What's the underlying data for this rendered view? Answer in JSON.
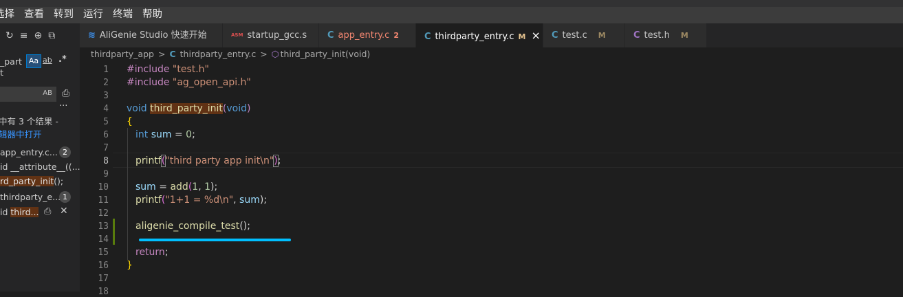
{
  "menu": {
    "items": [
      "选择",
      "查看",
      "转到",
      "运行",
      "终端",
      "帮助"
    ]
  },
  "sidebar": {
    "tools": [
      "↻",
      "≡",
      "⊕",
      "⧉"
    ],
    "search_prefix": "_part",
    "search_fragment": "t",
    "opt_case": "Aa",
    "opt_word": "ab",
    "opt_regex": ".*",
    "replace_opt": "AB",
    "more": "···",
    "result_text": "中有 3 个结果 -",
    "open_link": "辑器中打开",
    "results": [
      {
        "file": "app_entry.c...",
        "badge": "2"
      },
      {
        "line": "id __attribute__((..."
      },
      {
        "line_hl": "rd_party_init",
        "line_tail": "();"
      },
      {
        "file": "thirdparty_e...",
        "badge": "1"
      },
      {
        "line_pre": "id ",
        "line_hl": "third..."
      }
    ]
  },
  "tabs": [
    {
      "icon": "≋",
      "label": "AliGenie Studio 快速开始",
      "color": "#c5c5c5",
      "icon_color": "#3c8ee8",
      "badge": ""
    },
    {
      "icon": "ASM",
      "label": "startup_gcc.s",
      "color": "#c5c5c5",
      "icon_color": "#e05050",
      "badge": ""
    },
    {
      "icon": "C",
      "label": "app_entry.c",
      "color": "#f48771",
      "icon_color": "#519aba",
      "badge": "2"
    },
    {
      "icon": "C",
      "label": "thirdparty_entry.c",
      "color": "#ffffff",
      "icon_color": "#519aba",
      "badge": "M",
      "active": true,
      "close": "×"
    },
    {
      "icon": "C",
      "label": "test.c",
      "color": "#c5c5c5",
      "icon_color": "#519aba",
      "badge": "M"
    },
    {
      "icon": "C",
      "label": "test.h",
      "color": "#c5c5c5",
      "icon_color": "#a074c4",
      "badge": "M"
    }
  ],
  "breadcrumb": {
    "folder": "thirdparty_app",
    "sep": ">",
    "file_icon": "C",
    "file": "thirdparty_entry.c",
    "symbol": "third_party_init(void)"
  },
  "editor": {
    "line_numbers": [
      "1",
      "2",
      "3",
      "4",
      "5",
      "6",
      "7",
      "8",
      "9",
      "10",
      "11",
      "12",
      "13",
      "14",
      "15",
      "16",
      "17",
      "18"
    ],
    "current_line": "8",
    "lines": {
      "l1a": "#include ",
      "l1b": "\"test.h\"",
      "l2a": "#include ",
      "l2b": "\"ag_open_api.h\"",
      "l4a": "void ",
      "l4b": "third_party_init",
      "l4c": "(",
      "l4d": "void",
      "l4e": ")",
      "l5": "{",
      "l6a": "int ",
      "l6b": "sum",
      "l6c": " = ",
      "l6d": "0",
      "l6e": ";",
      "l8a": "printf",
      "l8b": "(",
      "l8c": "\"third party app init\\n\"",
      "l8d": ")",
      "l8e": ";",
      "l10a": "sum",
      "l10b": " = ",
      "l10c": "add",
      "l10d": "(",
      "l10e": "1",
      "l10f": ", ",
      "l10g": "1",
      "l10h": ");",
      "l11a": "printf",
      "l11b": "(",
      "l11c": "\"1+1 = %d\\n\"",
      "l11d": ", ",
      "l11e": "sum",
      "l11f": ");",
      "l13a": "aligenie_compile_test",
      "l13b": "();",
      "l15a": "return",
      "l15b": ";",
      "l16": "}"
    }
  }
}
